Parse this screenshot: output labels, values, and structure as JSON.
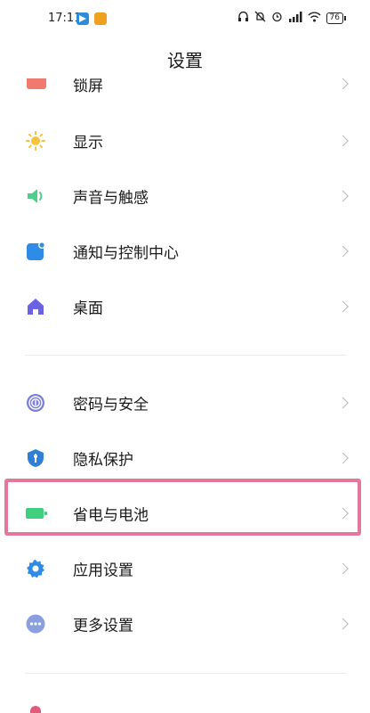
{
  "status_bar": {
    "time": "17:11",
    "battery": "76"
  },
  "header": {
    "title": "设置"
  },
  "settings": {
    "items": [
      {
        "label": "锁屏",
        "icon": "lock-screen-icon",
        "color": "#f07a6e"
      },
      {
        "label": "显示",
        "icon": "sun-icon",
        "color": "#f7c23b"
      },
      {
        "label": "声音与触感",
        "icon": "speaker-icon",
        "color": "#4fcf8a"
      },
      {
        "label": "通知与控制中心",
        "icon": "notification-icon",
        "color": "#2f8be8"
      },
      {
        "label": "桌面",
        "icon": "home-icon",
        "color": "#6b63e3"
      },
      {
        "label": "密码与安全",
        "icon": "fingerprint-icon",
        "color": "#7a7fd8"
      },
      {
        "label": "隐私保护",
        "icon": "privacy-shield-icon",
        "color": "#2f7fd6"
      },
      {
        "label": "省电与电池",
        "icon": "battery-icon",
        "color": "#3fcf7f"
      },
      {
        "label": "应用设置",
        "icon": "gear-icon",
        "color": "#2f8be8"
      },
      {
        "label": "更多设置",
        "icon": "more-dots-icon",
        "color": "#8a9fe0"
      }
    ]
  }
}
